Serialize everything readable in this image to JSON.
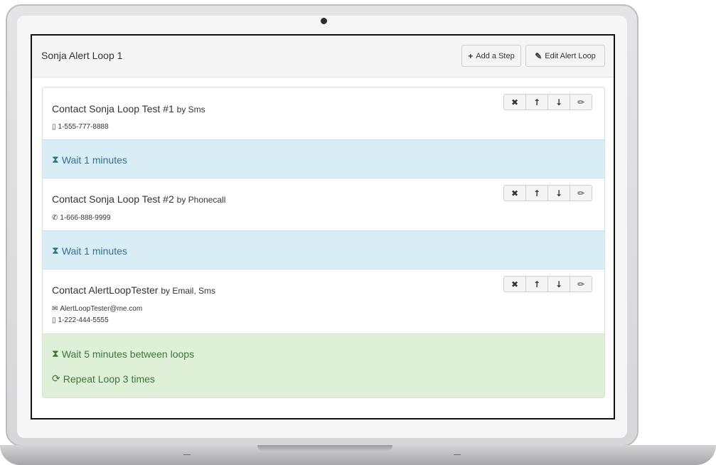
{
  "panel": {
    "title": "Sonja Alert Loop 1",
    "add_step_label": "Add a Step",
    "edit_loop_label": "Edit Alert Loop"
  },
  "icons": {
    "plus": "+",
    "edit": "✎",
    "remove": "✖",
    "up": "↑",
    "down": "↓",
    "pencil": "✏",
    "mobile": "▯",
    "phone": "✆",
    "envelope": "✉",
    "hourglass": "⧗",
    "refresh": "⟳"
  },
  "steps": [
    {
      "name": "Contact Sonja Loop Test #1",
      "by": "by Sms",
      "details": [
        {
          "icon": "mobile-icon",
          "text": "1-555-777-8888"
        }
      ]
    },
    {
      "name": "Contact Sonja Loop Test #2",
      "by": "by Phonecall",
      "details": [
        {
          "icon": "phone-icon",
          "text": "1-666-888-9999"
        }
      ]
    },
    {
      "name": "Contact AlertLoopTester",
      "by": "by Email, Sms",
      "details": [
        {
          "icon": "envelope-icon",
          "text": "AlertLoopTester@me.com"
        },
        {
          "icon": "mobile-icon",
          "text": "1-222-444-5555"
        }
      ]
    }
  ],
  "waits": [
    {
      "text": "Wait 1 minutes"
    },
    {
      "text": "Wait 1 minutes"
    }
  ],
  "loop": {
    "wait_text": "Wait 5 minutes between loops",
    "repeat_text": "Repeat Loop 3 times"
  },
  "colors": {
    "wait_background": "#d9edf7",
    "wait_text": "#31708f",
    "loop_background": "#dff0d8",
    "loop_text": "#3c763d"
  }
}
